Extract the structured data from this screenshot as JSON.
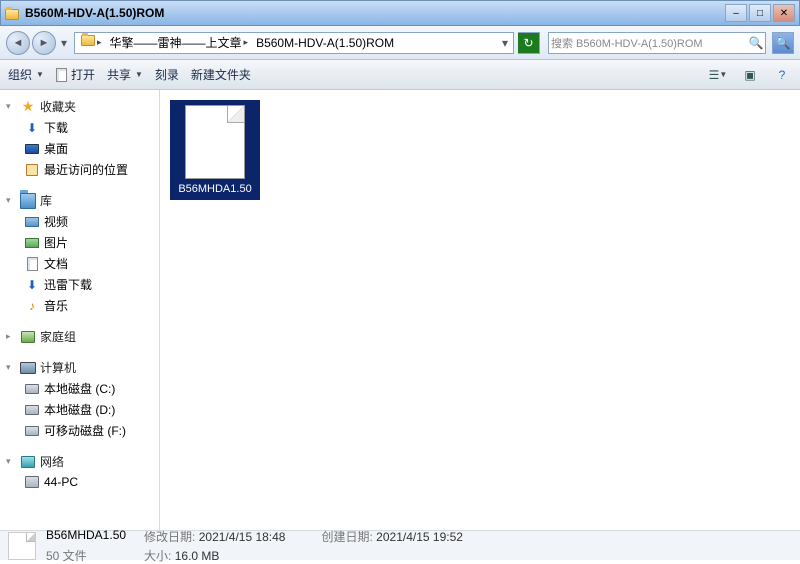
{
  "window": {
    "title": "B560M-HDV-A(1.50)ROM"
  },
  "nav": {
    "path_seg1": "华擎——雷神——上文章",
    "path_seg2": "B560M-HDV-A(1.50)ROM",
    "search_placeholder": "搜索 B560M-HDV-A(1.50)ROM"
  },
  "toolbar": {
    "organize": "组织",
    "open": "打开",
    "share": "共享",
    "burn": "刻录",
    "new_folder": "新建文件夹"
  },
  "sidebar": {
    "favorites": {
      "label": "收藏夹",
      "items": [
        "下载",
        "桌面",
        "最近访问的位置"
      ]
    },
    "libraries": {
      "label": "库",
      "items": [
        "视频",
        "图片",
        "文档",
        "迅雷下载",
        "音乐"
      ]
    },
    "homegroup": {
      "label": "家庭组"
    },
    "computer": {
      "label": "计算机",
      "items": [
        "本地磁盘 (C:)",
        "本地磁盘 (D:)",
        "可移动磁盘 (F:)"
      ]
    },
    "network": {
      "label": "网络",
      "items": [
        "44-PC"
      ]
    }
  },
  "files": [
    {
      "name": "B56MHDA1.50"
    }
  ],
  "status": {
    "filename": "B56MHDA1.50",
    "type": "50 文件",
    "mod_label": "修改日期:",
    "mod_value": "2021/4/15 18:48",
    "create_label": "创建日期:",
    "create_value": "2021/4/15 19:52",
    "size_label": "大小:",
    "size_value": "16.0 MB"
  }
}
